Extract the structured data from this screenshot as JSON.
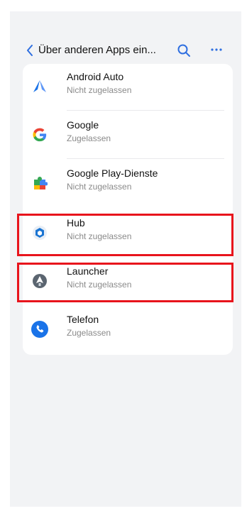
{
  "header": {
    "title": "Über anderen Apps ein...",
    "back_icon": "chevron-left-icon",
    "search_icon": "search-icon",
    "more_icon": "more-icon"
  },
  "apps": [
    {
      "name": "Android Auto",
      "status": "Nicht zugelassen",
      "icon": "android-auto-icon"
    },
    {
      "name": "Google",
      "status": "Zugelassen",
      "icon": "google-icon"
    },
    {
      "name": "Google Play-Dienste",
      "status": "Nicht zugelassen",
      "icon": "google-play-services-icon"
    },
    {
      "name": "Hub",
      "status": "Nicht zugelassen",
      "icon": "hub-icon"
    },
    {
      "name": "Launcher",
      "status": "Nicht zugelassen",
      "icon": "launcher-icon"
    },
    {
      "name": "Telefon",
      "status": "Zugelassen",
      "icon": "phone-icon"
    }
  ],
  "colors": {
    "accent": "#2f6fe0",
    "highlight": "#e8141c",
    "background": "#f2f3f5"
  }
}
